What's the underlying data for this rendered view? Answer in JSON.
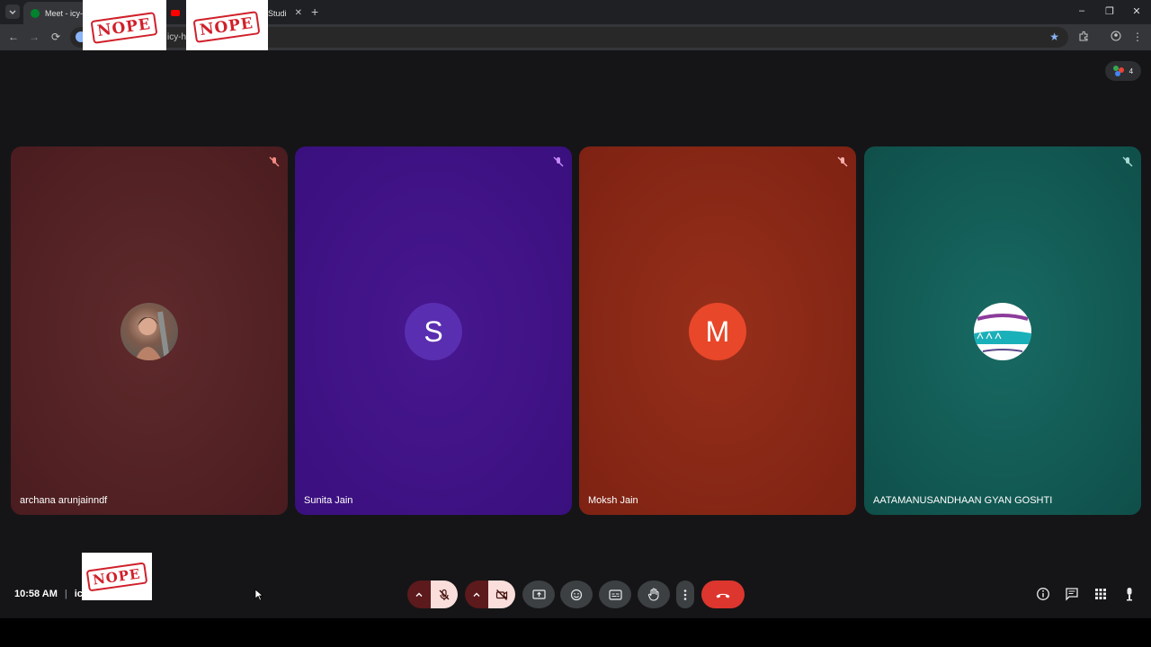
{
  "browser": {
    "tabs": [
      {
        "title": "Meet - icy-h",
        "active": true
      },
      {
        "title": "Studi",
        "active": false
      }
    ],
    "new_tab_label": "+",
    "window_controls": {
      "minimize": "–",
      "restore": "❐",
      "close": "✕"
    },
    "url": "icy-hsj",
    "redaction_label": "NOPE"
  },
  "meet": {
    "participant_count": "4",
    "participants": [
      {
        "name": "archana arunjainndf",
        "initial": "",
        "bg": "#5a2528"
      },
      {
        "name": "Sunita Jain",
        "initial": "S",
        "bg": "#40138a"
      },
      {
        "name": "Moksh Jain",
        "initial": "M",
        "bg": "#8a2514"
      },
      {
        "name": "AATAMANUSANDHAAN GYAN GOSHTI",
        "initial": "",
        "bg": "#135b55"
      }
    ],
    "clock": "10:58 AM",
    "separator": "|",
    "meeting_code": "icy",
    "colors": {
      "end_call": "#dc362e",
      "muted_control": "#f9dedc",
      "accent_blue": "#8ab4f8"
    }
  }
}
